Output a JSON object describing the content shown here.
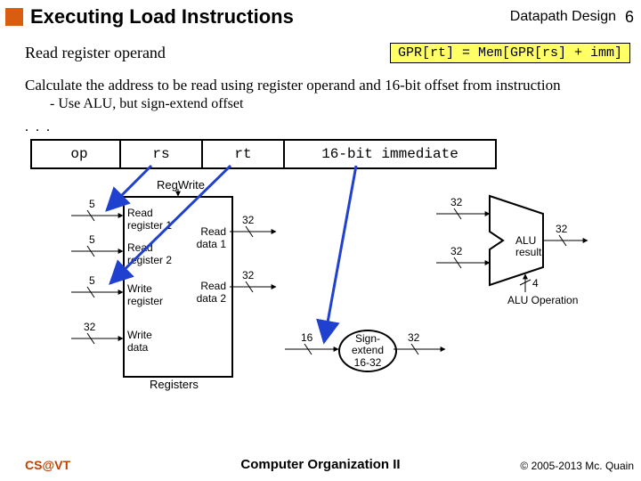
{
  "header": {
    "title": "Executing Load Instructions",
    "chapter": "Datapath Design",
    "slideNumber": "6"
  },
  "subheader": {
    "left": "Read register operand",
    "code": "GPR[rt] = Mem[GPR[rs] + imm]"
  },
  "desc": {
    "line1": "Calculate the address to be read using register operand and 16-bit offset from instruction",
    "line2": "-   Use ALU, but sign-extend offset",
    "dots": ". . ."
  },
  "fields": {
    "op": "op",
    "rs": "rs",
    "rt": "rt",
    "imm": "16-bit immediate"
  },
  "diagram": {
    "regwrite": "RegWrite",
    "registers": "Registers",
    "ports": {
      "readReg1": "Read\nregister 1",
      "readReg2": "Read\nregister 2",
      "writeReg": "Write\nregister",
      "writeData": "Write\ndata",
      "readData1": "Read\ndata 1",
      "readData2": "Read\ndata 2"
    },
    "signExtend": "Sign-\nextend\n16-32",
    "aluResult": "ALU\nresult",
    "aluOp": "ALU Operation",
    "bits": {
      "b5a": "5",
      "b5b": "5",
      "b5c": "5",
      "b32a": "32",
      "b32b": "32",
      "b32c": "32",
      "b32d": "32",
      "b32e": "32",
      "b32f": "32",
      "b32g": "32",
      "b16": "16",
      "b4": "4"
    }
  },
  "footer": {
    "left": "CS@VT",
    "center": "Computer Organization II",
    "right": "© 2005-2013 Mc. Quain"
  }
}
